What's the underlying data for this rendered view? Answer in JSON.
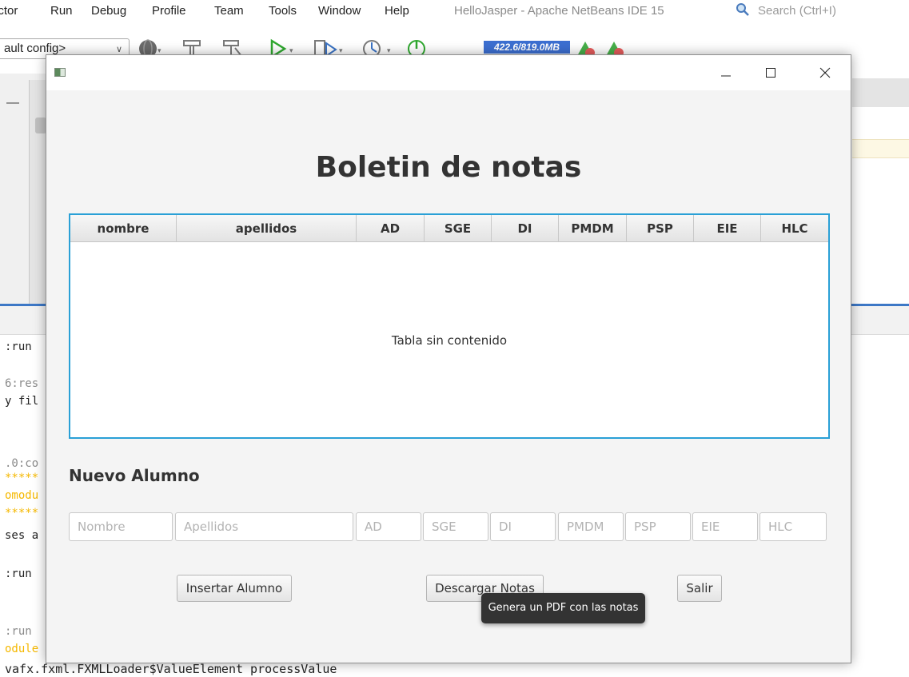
{
  "ide": {
    "menu": [
      "ictor",
      "Run",
      "Debug",
      "Profile",
      "Team",
      "Tools",
      "Window",
      "Help"
    ],
    "title": "HelloJasper - Apache NetBeans IDE 15",
    "search_placeholder": "Search (Ctrl+I)",
    "config_selector": "ault config>",
    "memory": "422.6/819.0MB",
    "output_lines": [
      ":run",
      "6:res",
      "y fil",
      ".0:co",
      "*****",
      "omodu",
      "*****",
      "ses a",
      ":run",
      ":run",
      "odule"
    ],
    "bottom_line": "vafx.fxml.FXMLLoader$ValueElement processValue"
  },
  "window": {
    "controls": {
      "minimize": "minimize-icon",
      "maximize": "maximize-icon",
      "close": "close-icon"
    }
  },
  "app": {
    "heading": "Boletin de notas",
    "table": {
      "columns": [
        "nombre",
        "apellidos",
        "AD",
        "SGE",
        "DI",
        "PMDM",
        "PSP",
        "EIE",
        "HLC"
      ],
      "empty_message": "Tabla sin contenido",
      "rows": []
    },
    "form": {
      "title": "Nuevo Alumno",
      "fields": [
        {
          "placeholder": "Nombre",
          "value": ""
        },
        {
          "placeholder": "Apellidos",
          "value": ""
        },
        {
          "placeholder": "AD",
          "value": ""
        },
        {
          "placeholder": "SGE",
          "value": ""
        },
        {
          "placeholder": "DI",
          "value": ""
        },
        {
          "placeholder": "PMDM",
          "value": ""
        },
        {
          "placeholder": "PSP",
          "value": ""
        },
        {
          "placeholder": "EIE",
          "value": ""
        },
        {
          "placeholder": "HLC",
          "value": ""
        }
      ]
    },
    "buttons": {
      "insert": "Insertar Alumno",
      "download": "Descargar Notas",
      "exit": "Salir"
    },
    "tooltip": "Genera un PDF con las notas"
  }
}
